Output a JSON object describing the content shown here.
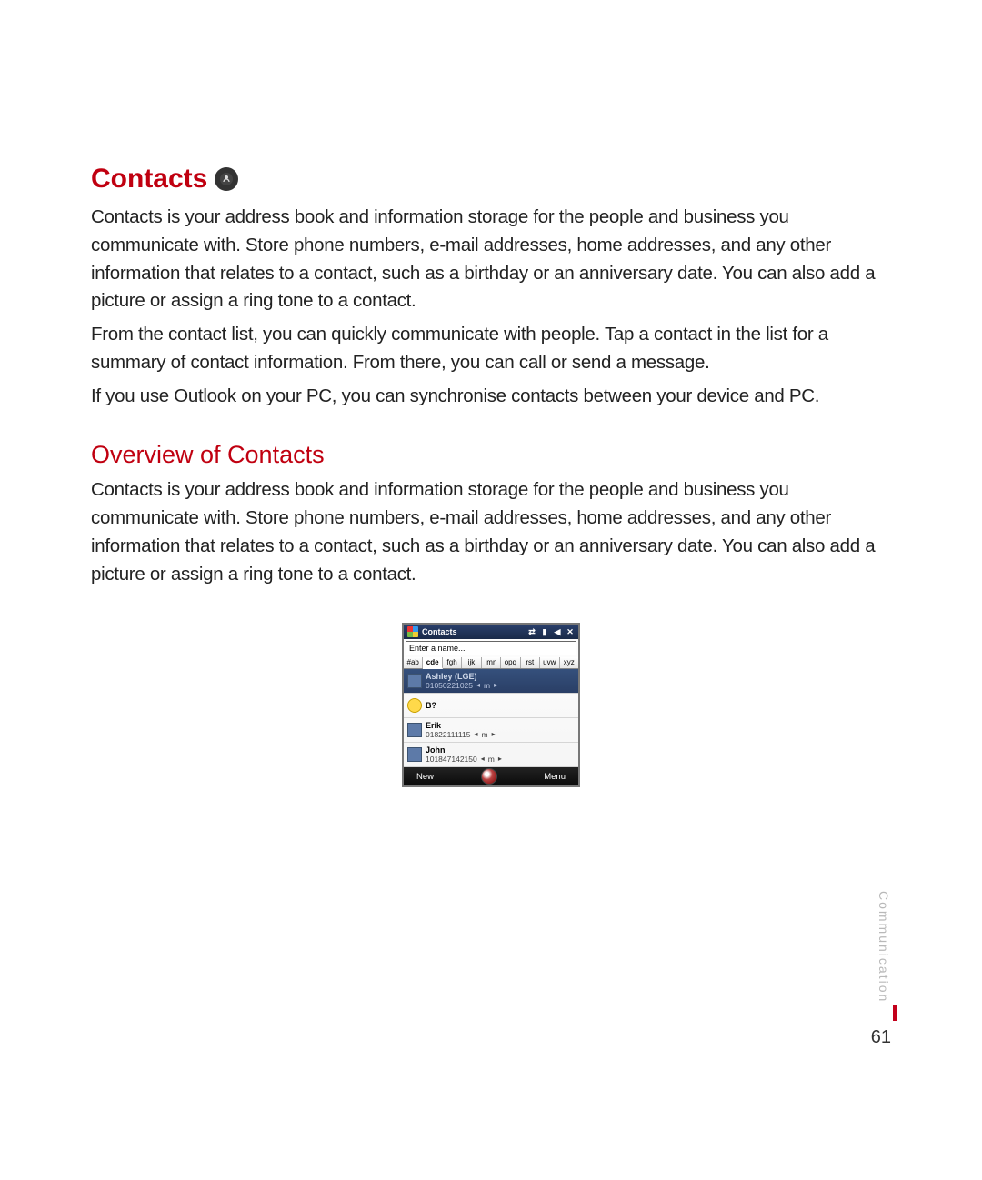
{
  "section": {
    "title": "Contacts",
    "icon_name": "contacts-app-icon",
    "paragraphs": [
      "Contacts is your address book and information storage for the people and business you communicate with. Store phone numbers, e-mail addresses, home addresses, and any other information that relates to a contact, such as a birthday or an anniversary date. You can also add a picture or assign a ring tone to a contact.",
      "From the contact list, you can quickly communicate with people. Tap a contact in the list for a summary of contact information. From there, you can call or send a message.",
      "If you use Outlook on your PC, you can synchronise contacts between your device and PC."
    ]
  },
  "subsection": {
    "title": "Overview of Contacts",
    "paragraph": "Contacts is your address book and information storage for the people and business you communicate with. Store phone numbers, e-mail addresses, home addresses, and any other information that relates to a contact, such as a birthday or an anniversary date. You can also add a picture or assign a ring tone to a contact."
  },
  "phone": {
    "titlebar": {
      "title": "Contacts"
    },
    "search_placeholder": "Enter a name...",
    "alpha_tabs": [
      "#ab",
      "cde",
      "fgh",
      "ijk",
      "lmn",
      "opq",
      "rst",
      "uvw",
      "xyz"
    ],
    "alpha_selected_index": 1,
    "contacts": [
      {
        "name": "Ashley (LGE)",
        "number": "01050221025",
        "type": "m",
        "selected": true,
        "avatar": "outlook"
      },
      {
        "name": "B?",
        "number": "",
        "type": "",
        "selected": false,
        "avatar": "msn"
      },
      {
        "name": "Erik",
        "number": "01822111115",
        "type": "m",
        "selected": false,
        "avatar": "outlook"
      },
      {
        "name": "John",
        "number": "101847142150",
        "type": "m",
        "selected": false,
        "avatar": "outlook"
      }
    ],
    "softkeys": {
      "left": "New",
      "right": "Menu"
    }
  },
  "sidetab": "Communication",
  "pagenum": "61"
}
